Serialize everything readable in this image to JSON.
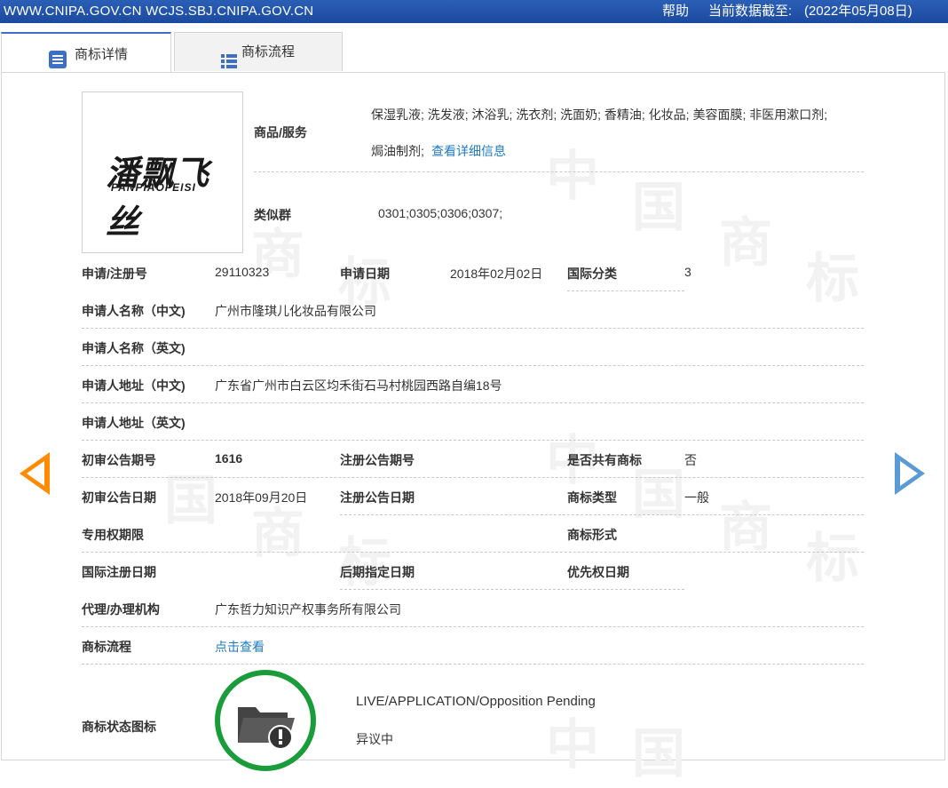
{
  "topbar": {
    "url": "WWW.CNIPA.GOV.CN WCJS.SBJ.CNIPA.GOV.CN",
    "help": "帮助",
    "asof_label": "当前数据截至:",
    "asof_date": "(2022年05月08日)"
  },
  "tabs": {
    "detail": "商标详情",
    "flow": "商标流程"
  },
  "watermark": [
    "中",
    "国",
    "商",
    "标"
  ],
  "logo": {
    "cn": "潘飘飞丝",
    "en": "PANPIAOFEISI"
  },
  "goods": {
    "label": "商品/服务",
    "line1": "保湿乳液; 洗发液; 沐浴乳; 洗衣剂; 洗面奶; 香精油; 化妆品; 美容面膜; 非医用漱口剂;",
    "line2": "焗油制剂;",
    "link": "查看详细信息"
  },
  "similar": {
    "label": "类似群",
    "value": "0301;0305;0306;0307;"
  },
  "fields": {
    "reg_no_label": "申请/注册号",
    "reg_no": "29110323",
    "app_date_label": "申请日期",
    "app_date": "2018年02月02日",
    "intl_class_label": "国际分类",
    "intl_class": "3",
    "applicant_cn_label": "申请人名称（中文)",
    "applicant_cn": "广州市隆琪儿化妆品有限公司",
    "applicant_en_label": "申请人名称（英文)",
    "address_cn_label": "申请人地址（中文)",
    "address_cn": "广东省广州市白云区均禾街石马村桃园西路自编18号",
    "address_en_label": "申请人地址（英文)",
    "prelim_issue_label": "初审公告期号",
    "prelim_issue": "1616",
    "reg_issue_label": "注册公告期号",
    "shared_label": "是否共有商标",
    "shared": "否",
    "prelim_date_label": "初审公告日期",
    "prelim_date": "2018年09月20日",
    "reg_date_label": "注册公告日期",
    "tm_type_label": "商标类型",
    "tm_type": "一般",
    "exclusive_label": "专用权期限",
    "tm_form_label": "商标形式",
    "intl_reg_date_label": "国际注册日期",
    "later_date_label": "后期指定日期",
    "priority_date_label": "优先权日期",
    "agent_label": "代理/办理机构",
    "agent": "广东哲力知识产权事务所有限公司",
    "flow_label": "商标流程",
    "flow_link": "点击查看",
    "status_icon_label": "商标状态图标",
    "status_en": "LIVE/APPLICATION/Opposition Pending",
    "status_cn": "异议中"
  },
  "colors": {
    "topbar": "#1f4fa6",
    "link": "#1f7bc0",
    "prev_arrow": "#ff8c00",
    "next_arrow": "#5b9bd5",
    "status_ring": "#1a9c3a"
  }
}
